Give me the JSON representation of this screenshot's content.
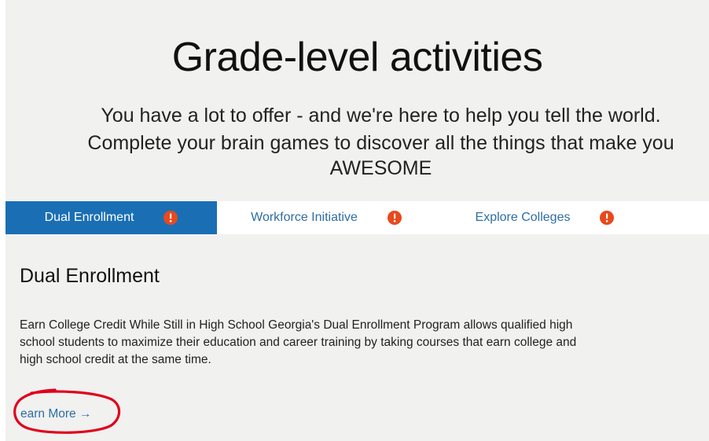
{
  "hero": {
    "title": "Grade-level activities",
    "subtitle_line_1": "You have a lot to offer - and we're here to help you tell the world.",
    "subtitle_line_2": "Complete your brain games to discover all the things that make you",
    "subtitle_line_3": "AWESOME"
  },
  "tabs": [
    {
      "label": "Dual Enrollment",
      "active": true,
      "icon": "alert-icon"
    },
    {
      "label": "Workforce Initiative",
      "active": false,
      "icon": "alert-icon"
    },
    {
      "label": "Explore Colleges",
      "active": false,
      "icon": "alert-icon"
    }
  ],
  "section": {
    "heading": "Dual Enrollment",
    "description": "Earn College Credit While Still in High School Georgia's Dual Enrollment Program allows qualified high school students to maximize their education and career training by taking courses that earn college and high school credit at the same time.",
    "learn_more_label": "earn More →"
  },
  "colors": {
    "active_tab": "#1a6fb4",
    "link": "#2e6da4",
    "alert": "#e8491d",
    "annotation": "#e0001b",
    "background": "#f1f1f0"
  }
}
